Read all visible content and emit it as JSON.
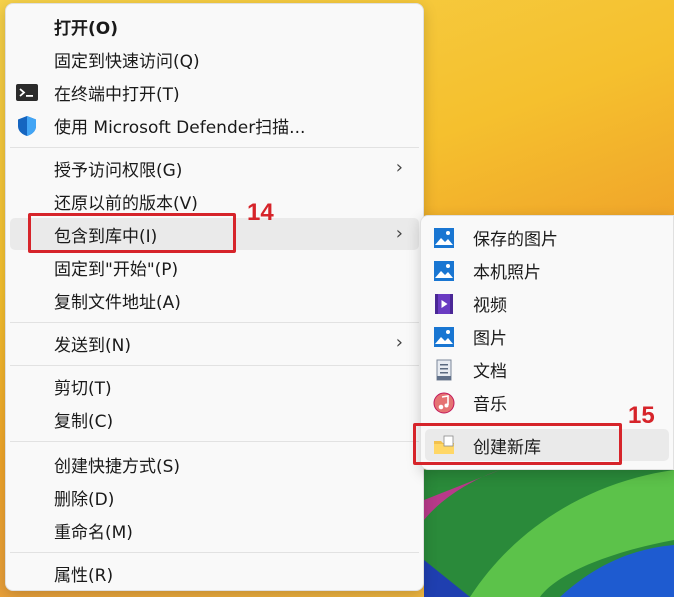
{
  "menu": {
    "items": [
      {
        "label": "打开(O)",
        "icon": "",
        "bold": true
      },
      {
        "label": "固定到快速访问(Q)",
        "icon": ""
      },
      {
        "label": "在终端中打开(T)",
        "icon": "terminal-icon"
      },
      {
        "label": "使用 Microsoft Defender扫描...",
        "icon": "defender-shield-icon"
      },
      {
        "label": "授予访问权限(G)",
        "icon": "",
        "submenu": true
      },
      {
        "label": "还原以前的版本(V)",
        "icon": ""
      },
      {
        "label": "包含到库中(I)",
        "icon": "",
        "submenu": true,
        "highlighted": true
      },
      {
        "label": "固定到\"开始\"(P)",
        "icon": ""
      },
      {
        "label": "复制文件地址(A)",
        "icon": ""
      },
      {
        "label": "发送到(N)",
        "icon": "",
        "submenu": true
      },
      {
        "label": "剪切(T)",
        "icon": ""
      },
      {
        "label": "复制(C)",
        "icon": ""
      },
      {
        "label": "创建快捷方式(S)",
        "icon": ""
      },
      {
        "label": "删除(D)",
        "icon": ""
      },
      {
        "label": "重命名(M)",
        "icon": ""
      },
      {
        "label": "属性(R)",
        "icon": ""
      }
    ],
    "chevron": "›"
  },
  "submenu": {
    "items": [
      {
        "label": "保存的图片",
        "icon": "picture-library-icon"
      },
      {
        "label": "本机照片",
        "icon": "picture-library-icon"
      },
      {
        "label": "视频",
        "icon": "video-library-icon"
      },
      {
        "label": "图片",
        "icon": "picture-library-icon"
      },
      {
        "label": "文档",
        "icon": "document-library-icon"
      },
      {
        "label": "音乐",
        "icon": "music-library-icon"
      },
      {
        "label": "创建新库",
        "icon": "new-library-folder-icon",
        "highlighted": true
      }
    ]
  },
  "annotations": {
    "step14": "14",
    "step15": "15"
  },
  "colors": {
    "annotation_red": "#d6242a",
    "highlight": "#eaeaea",
    "menu_bg": "#f9f9f9"
  }
}
